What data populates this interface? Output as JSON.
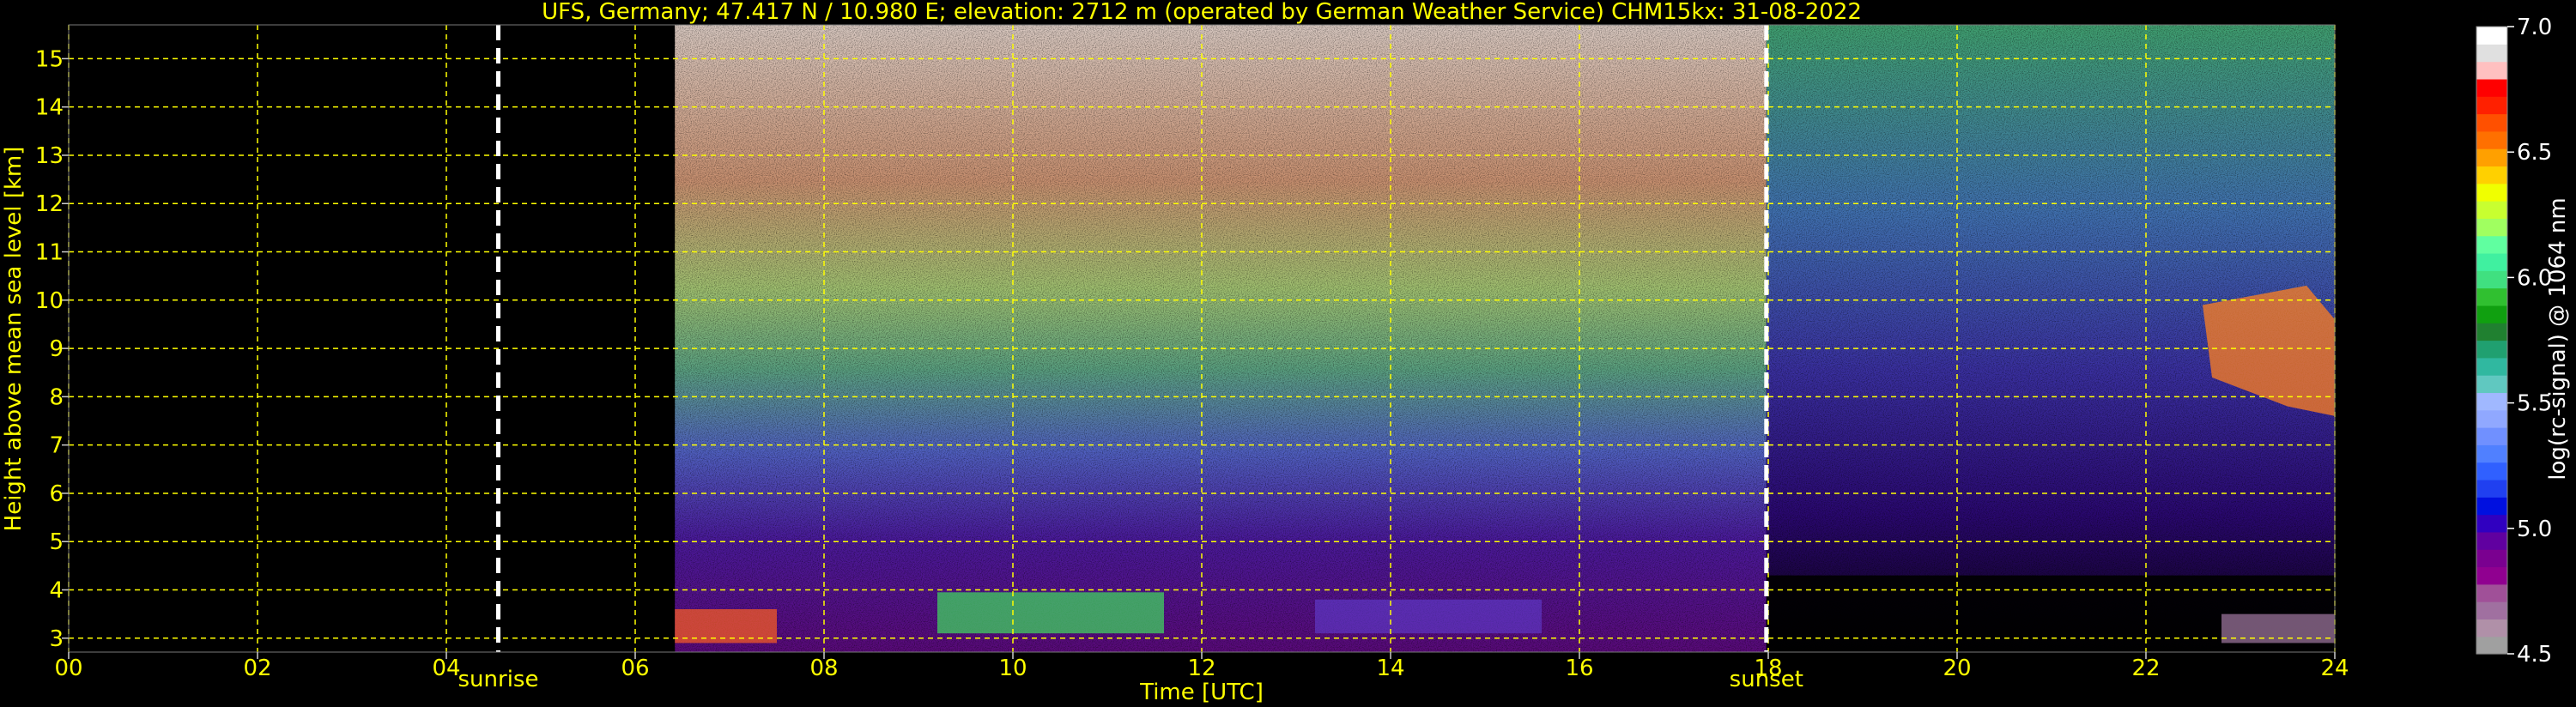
{
  "chart_data": {
    "type": "heatmap",
    "title": "UFS, Germany; 47.417 N / 10.980 E; elevation: 2712 m  (operated by German Weather Service)    CHM15kx: 31-08-2022",
    "xlabel": "Time [UTC]",
    "ylabel": "Height above mean sea level [km]",
    "xlim": [
      0,
      24
    ],
    "ylim": [
      2.712,
      15.7
    ],
    "xticks": [
      "00",
      "02",
      "04",
      "06",
      "08",
      "10",
      "12",
      "14",
      "16",
      "18",
      "20",
      "22",
      "24"
    ],
    "yticks": [
      "3",
      "4",
      "5",
      "6",
      "7",
      "8",
      "9",
      "10",
      "11",
      "12",
      "13",
      "14",
      "15"
    ],
    "grid": true,
    "colorbar": {
      "label": "log(rc-signal) @ 1064 nm",
      "range": [
        4.5,
        7.0
      ],
      "ticks": [
        "4.5",
        "5.0",
        "5.5",
        "6.0",
        "6.5",
        "7.0"
      ],
      "colors": [
        "#a0a0a0",
        "#b090a8",
        "#a070a0",
        "#a05098",
        "#900090",
        "#7a0090",
        "#6000a0",
        "#3000c0",
        "#0010e0",
        "#2040f0",
        "#3060ff",
        "#5080ff",
        "#7090ff",
        "#90a8ff",
        "#a0b8ff",
        "#60c8c0",
        "#30b8a0",
        "#20a070",
        "#208030",
        "#10a010",
        "#30c030",
        "#40e080",
        "#40f0a0",
        "#60ffa0",
        "#a0ff60",
        "#c8ff30",
        "#f0ff00",
        "#ffd000",
        "#ffa000",
        "#ff7000",
        "#ff5000",
        "#ff2000",
        "#ff0000",
        "#ffc0c0",
        "#e0e0e0",
        "#ffffff"
      ]
    },
    "markers": [
      {
        "x": 4.55,
        "label": "sunrise"
      },
      {
        "x": 17.98,
        "label": "sunset"
      }
    ],
    "data_start_hour": 6.42
  },
  "colors": {
    "text": "#ffff00",
    "grid": "#ffff00",
    "marker": "#ffffff",
    "background": "#000000"
  }
}
